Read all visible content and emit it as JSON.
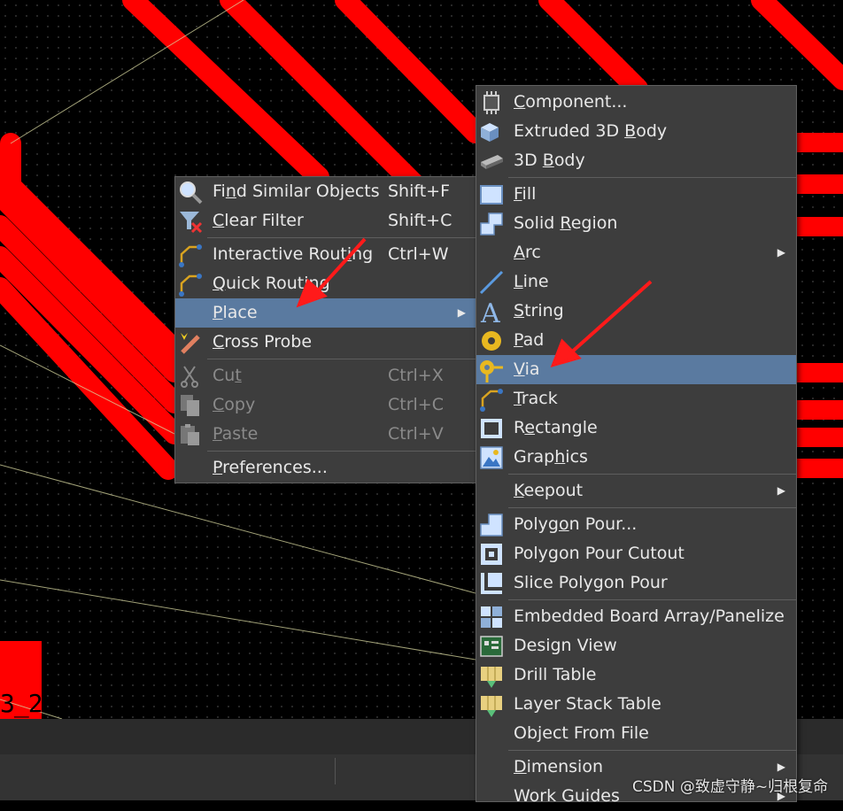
{
  "canvas": {
    "component_label": "3_2",
    "colors": {
      "trace": "#ff0000",
      "ratsnest": "#d8d8a0",
      "background": "#000000",
      "menu_bg": "#3d3d3d",
      "highlight": "#5a7aa0"
    }
  },
  "context_menu": {
    "items": [
      {
        "icon": "find-similar-icon",
        "label_pre": "Fi",
        "label_u": "n",
        "label_post": "d Similar Objects",
        "shortcut": "Shift+F"
      },
      {
        "icon": "clear-filter-icon",
        "label_pre": "",
        "label_u": "C",
        "label_post": "lear Filter",
        "shortcut": "Shift+C"
      },
      {
        "icon": "interactive-routing-icon",
        "label_pre": "Interactive Rout",
        "label_u": "i",
        "label_post": "ng",
        "shortcut": "Ctrl+W"
      },
      {
        "icon": "quick-routing-icon",
        "label_pre": "",
        "label_u": "Q",
        "label_post": "uick Routing",
        "shortcut": ""
      },
      {
        "icon": "",
        "label_pre": "",
        "label_u": "P",
        "label_post": "lace",
        "shortcut": ""
      },
      {
        "icon": "cross-probe-icon",
        "label_pre": "",
        "label_u": "C",
        "label_post": "ross Probe",
        "shortcut": ""
      },
      {
        "icon": "cut-icon",
        "label_pre": "Cu",
        "label_u": "t",
        "label_post": "",
        "shortcut": "Ctrl+X"
      },
      {
        "icon": "copy-icon",
        "label_pre": "",
        "label_u": "C",
        "label_post": "opy",
        "shortcut": "Ctrl+C"
      },
      {
        "icon": "paste-icon",
        "label_pre": "",
        "label_u": "P",
        "label_post": "aste",
        "shortcut": "Ctrl+V"
      },
      {
        "icon": "",
        "label_pre": "",
        "label_u": "P",
        "label_post": "references...",
        "shortcut": ""
      }
    ]
  },
  "place_submenu": {
    "items": [
      {
        "icon": "component-icon",
        "label_pre": "",
        "label_u": "C",
        "label_post": "omponent..."
      },
      {
        "icon": "extruded-3d-body-icon",
        "label_pre": "Extruded 3D ",
        "label_u": "B",
        "label_post": "ody"
      },
      {
        "icon": "3d-body-icon",
        "label_pre": "3D ",
        "label_u": "B",
        "label_post": "ody"
      },
      {
        "icon": "fill-icon",
        "label_pre": "",
        "label_u": "F",
        "label_post": "ill"
      },
      {
        "icon": "solid-region-icon",
        "label_pre": "Solid ",
        "label_u": "R",
        "label_post": "egion"
      },
      {
        "icon": "",
        "label_pre": "",
        "label_u": "A",
        "label_post": "rc"
      },
      {
        "icon": "line-icon",
        "label_pre": "",
        "label_u": "L",
        "label_post": "ine"
      },
      {
        "icon": "string-icon",
        "label_pre": "",
        "label_u": "S",
        "label_post": "tring"
      },
      {
        "icon": "pad-icon",
        "label_pre": "",
        "label_u": "P",
        "label_post": "ad"
      },
      {
        "icon": "via-icon",
        "label_pre": "",
        "label_u": "V",
        "label_post": "ia"
      },
      {
        "icon": "track-icon",
        "label_pre": "",
        "label_u": "T",
        "label_post": "rack"
      },
      {
        "icon": "rectangle-icon",
        "label_pre": "R",
        "label_u": "e",
        "label_post": "ctangle"
      },
      {
        "icon": "graphics-icon",
        "label_pre": "Grap",
        "label_u": "h",
        "label_post": "ics"
      },
      {
        "icon": "",
        "label_pre": "",
        "label_u": "K",
        "label_post": "eepout"
      },
      {
        "icon": "polygon-pour-icon",
        "label_pre": "Polyg",
        "label_u": "o",
        "label_post": "n Pour..."
      },
      {
        "icon": "polygon-pour-cutout-icon",
        "label_pre": "Polygon Pour Cutout",
        "label_u": "",
        "label_post": ""
      },
      {
        "icon": "slice-polygon-pour-icon",
        "label_pre": "Slice Polygon Pour",
        "label_u": "",
        "label_post": ""
      },
      {
        "icon": "embedded-board-array-icon",
        "label_pre": "Embedded Board Array/Panelize",
        "label_u": "",
        "label_post": ""
      },
      {
        "icon": "design-view-icon",
        "label_pre": "Design View",
        "label_u": "",
        "label_post": ""
      },
      {
        "icon": "drill-table-icon",
        "label_pre": "Drill Table",
        "label_u": "",
        "label_post": ""
      },
      {
        "icon": "layer-stack-table-icon",
        "label_pre": "Layer Stack Table",
        "label_u": "",
        "label_post": ""
      },
      {
        "icon": "",
        "label_pre": "Object From File",
        "label_u": "",
        "label_post": ""
      },
      {
        "icon": "",
        "label_pre": "",
        "label_u": "D",
        "label_post": "imension"
      },
      {
        "icon": "",
        "label_pre": "Work Guides",
        "label_u": "",
        "label_post": ""
      }
    ]
  },
  "watermark": "CSDN @致虚守静~归根复命"
}
